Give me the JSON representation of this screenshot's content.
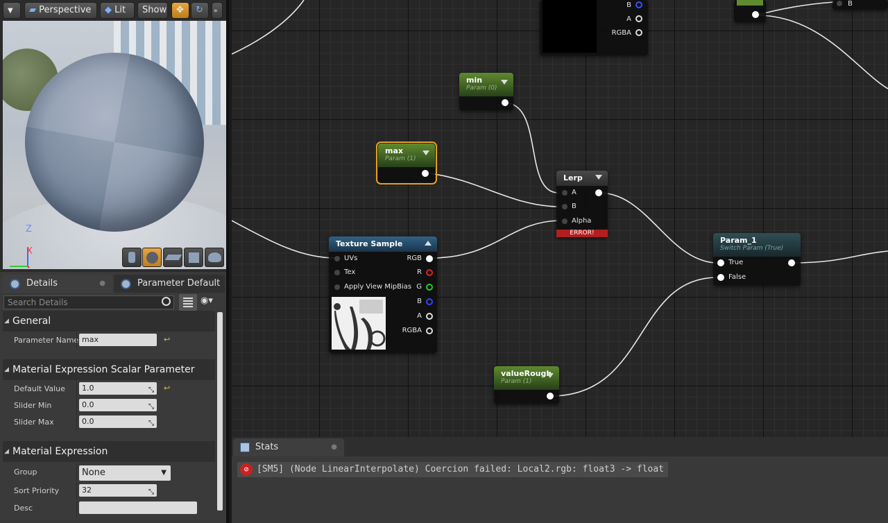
{
  "viewport": {
    "perspective_label": "Perspective",
    "lit_label": "Lit",
    "show_label": "Show",
    "axis_z": "Z",
    "axis_x": "X"
  },
  "details": {
    "tab_details": "Details",
    "tab_param_default": "Parameter Default",
    "search_placeholder": "Search Details",
    "general": {
      "title": "General",
      "param_name_label": "Parameter Name",
      "param_name_value": "max"
    },
    "scalar": {
      "title": "Material Expression Scalar Parameter",
      "default_label": "Default Value",
      "default_value": "1.0",
      "slider_min_label": "Slider Min",
      "slider_min_value": "0.0",
      "slider_max_label": "Slider Max",
      "slider_max_value": "0.0"
    },
    "expression": {
      "title": "Material Expression",
      "group_label": "Group",
      "group_value": "None",
      "sort_label": "Sort Priority",
      "sort_value": "32",
      "desc_label": "Desc",
      "desc_value": ""
    }
  },
  "graph": {
    "top_node": {
      "pins": [
        "B",
        "A",
        "RGBA"
      ]
    },
    "top_right_node": {
      "pin": "B"
    },
    "min": {
      "title": "min",
      "sub": "Param (0)"
    },
    "max": {
      "title": "max",
      "sub": "Param (1)"
    },
    "lerp": {
      "title": "Lerp",
      "pins": [
        "A",
        "B",
        "Alpha"
      ],
      "error": "ERROR!"
    },
    "texture": {
      "title": "Texture Sample",
      "inputs": [
        "UVs",
        "Tex",
        "Apply View MipBias"
      ],
      "outputs": [
        "RGB",
        "R",
        "G",
        "B",
        "A",
        "RGBA"
      ]
    },
    "param1": {
      "title": "Param_1",
      "sub": "Switch Param (True)",
      "pins": [
        "True",
        "False"
      ]
    },
    "valuerough": {
      "title": "valueRough",
      "sub": "Param (1)"
    }
  },
  "stats": {
    "tab_label": "Stats",
    "message": "[SM5] (Node LinearInterpolate) Coercion failed: Local2.rgb: float3 -> float"
  },
  "colors": {
    "accent_orange": "#e8a11e",
    "error_red": "#b31e1e",
    "param_green": "#5f8a2f",
    "texture_blue": "#2f6286"
  }
}
